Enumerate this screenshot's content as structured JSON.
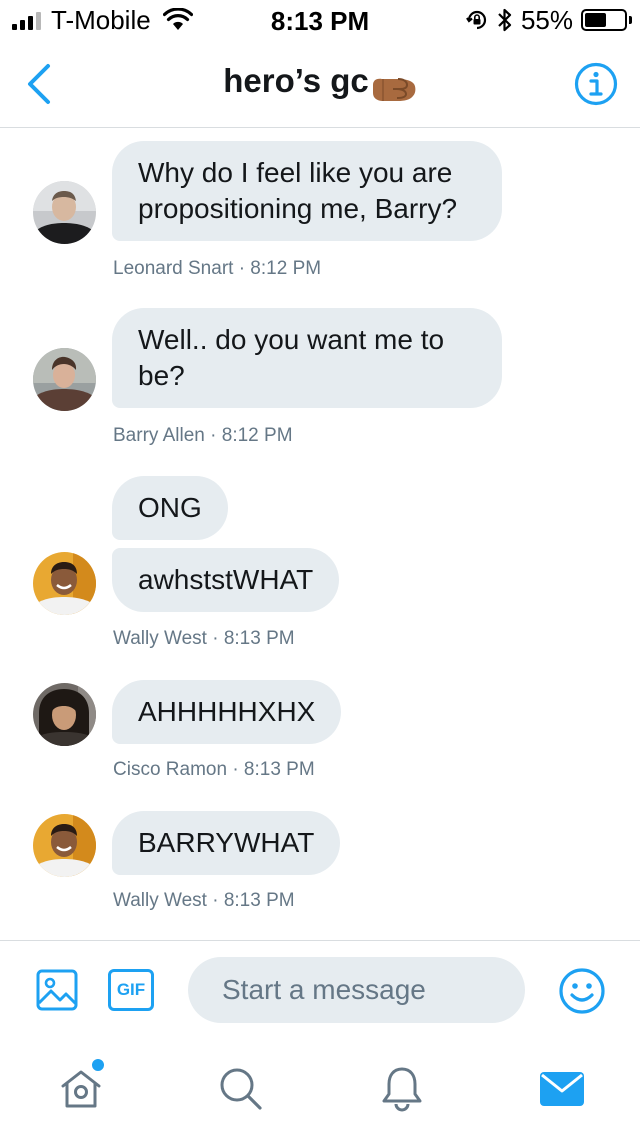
{
  "status_bar": {
    "carrier": "T-Mobile",
    "time": "8:13 PM",
    "battery_percent": "55%",
    "battery_level": 0.55,
    "icons": [
      "signal-icon",
      "wifi-icon",
      "rotation-lock-icon",
      "bluetooth-icon",
      "battery-icon"
    ]
  },
  "header": {
    "title": "hero’s gc",
    "title_emoji": "fist-emoji",
    "back_icon": "chevron-left-icon",
    "info_icon": "info-icon"
  },
  "messages": [
    {
      "sender": "Leonard Snart",
      "time": "8:12 PM",
      "meta": "Leonard Snart · 8:12 PM",
      "bubbles": [
        "Why do I feel like you are propositioning me, Barry?"
      ]
    },
    {
      "sender": "Barry Allen",
      "time": "8:12 PM",
      "meta": "Barry Allen · 8:12 PM",
      "bubbles": [
        "Well.. do you want me to be?"
      ]
    },
    {
      "sender": "Wally West",
      "time": "8:13 PM",
      "meta": "Wally West · 8:13 PM",
      "bubbles": [
        "ONG",
        "awhststWHAT"
      ]
    },
    {
      "sender": "Cisco Ramon",
      "time": "8:13 PM",
      "meta": "Cisco Ramon · 8:13 PM",
      "bubbles": [
        "AHHHHHXHX"
      ]
    },
    {
      "sender": "Wally West",
      "time": "8:13 PM",
      "meta": "Wally West · 8:13 PM",
      "bubbles": [
        "BARRYWHAT"
      ]
    }
  ],
  "composer": {
    "placeholder": "Start a message",
    "gif_label": "GIF",
    "image_icon": "image-icon",
    "emoji_icon": "emoji-icon"
  },
  "tab_bar": {
    "tabs": [
      "home-icon",
      "search-icon",
      "notifications-icon",
      "messages-icon"
    ],
    "active": "messages-icon"
  },
  "colors": {
    "accent": "#1da1f2",
    "bubble_bg": "#e6ecf0",
    "meta_text": "#657786",
    "text": "#14171a"
  }
}
